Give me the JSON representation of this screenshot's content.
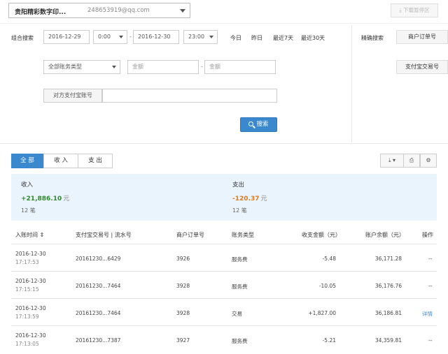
{
  "account": {
    "name": "贵阳精彩数字印...",
    "email": "248653919@qq.com"
  },
  "download_button": "下载暂停区",
  "search": {
    "combo_label": "组合搜索",
    "start_date": "2016-12-29",
    "start_time": "0:00",
    "end_date": "2016-12-30",
    "end_time": "23:00",
    "quick_ranges": [
      "今日",
      "昨日",
      "最近7天",
      "最近30天"
    ],
    "bill_type": "全部账务类型",
    "amount_min_placeholder": "金额",
    "amount_max_placeholder": "金额",
    "counterparty_label": "对方支付宝账号",
    "counterparty_value": "",
    "search_button": "搜索",
    "precise_label": "精确搜索",
    "precise_buttons": [
      "商户订单号",
      "支付宝交易号"
    ]
  },
  "tabs": [
    "全 部",
    "收 入",
    "支 出"
  ],
  "toolbar_icons": [
    "download-icon",
    "print-icon",
    "settings-icon"
  ],
  "colors": {
    "accent": "#3a89cf",
    "income": "#2e8b2e",
    "expense": "#e07a1f",
    "summary_bg": "#eaf4fc"
  },
  "summary": {
    "income_label": "收入",
    "income_amount": "+21,886.10",
    "income_unit": "元",
    "income_count": "12 笔",
    "expense_label": "支出",
    "expense_amount": "-120.37",
    "expense_unit": "元",
    "expense_count": "12 笔"
  },
  "table": {
    "headers": [
      "入账时间",
      "支付宝交易号 | 流水号",
      "商户订单号",
      "账务类型",
      "收支金额（元）",
      "账户余额（元）",
      "操作"
    ],
    "rows": [
      {
        "date": "2016-12-30",
        "time": "17:17:53",
        "txn": "20161230...6429",
        "order": "3926",
        "type": "服务费",
        "amount": "-5.48",
        "balance": "36,171.28",
        "op": "--"
      },
      {
        "date": "2016-12-30",
        "time": "17:15:15",
        "txn": "20161230...7464",
        "order": "3928",
        "type": "服务费",
        "amount": "-10.05",
        "balance": "36,176.76",
        "op": "--"
      },
      {
        "date": "2016-12-30",
        "time": "17:13:59",
        "txn": "20161230...7464",
        "order": "3928",
        "type": "交易",
        "amount": "+1,827.00",
        "balance": "36,186.81",
        "op": "详情"
      },
      {
        "date": "2016-12-30",
        "time": "17:13:05",
        "txn": "20161230...7387",
        "order": "3927",
        "type": "服务费",
        "amount": "-5.21",
        "balance": "34,359.81",
        "op": "--"
      }
    ]
  }
}
